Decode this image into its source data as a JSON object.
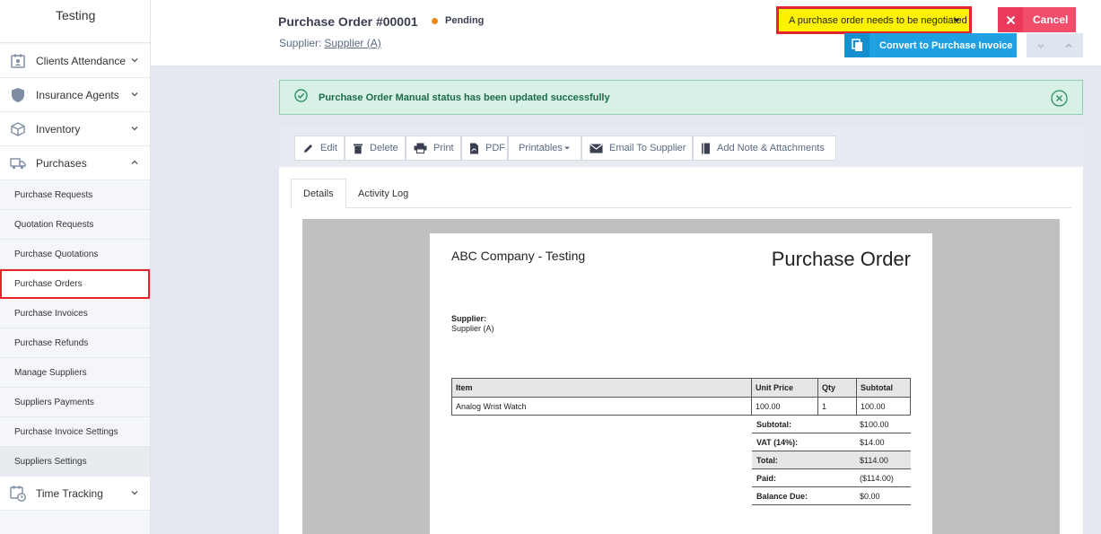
{
  "sidebar": {
    "brand": "Testing",
    "main_items": [
      {
        "label": "Clients Attendance",
        "icon": "calendar-user-icon"
      },
      {
        "label": "Insurance Agents",
        "icon": "shield-icon"
      },
      {
        "label": "Inventory",
        "icon": "box-icon"
      },
      {
        "label": "Purchases",
        "icon": "truck-icon"
      },
      {
        "label": "Time Tracking",
        "icon": "calendar-clock-icon"
      }
    ],
    "sub_items": [
      "Purchase Requests",
      "Quotation Requests",
      "Purchase Quotations",
      "Purchase Orders",
      "Purchase Invoices",
      "Purchase Refunds",
      "Manage Suppliers",
      "Suppliers Payments",
      "Purchase Invoice Settings",
      "Suppliers Settings"
    ],
    "active_sub_item": "Purchase Orders"
  },
  "header": {
    "title": "Purchase Order #00001",
    "status": "Pending",
    "status_color": "#f18a12",
    "supplier_label": "Supplier:",
    "supplier_name": "Supplier (A)",
    "status_select": "A purchase order needs to be negotiated",
    "cancel_label": "Cancel",
    "convert_label": "Convert to Purchase Invoice"
  },
  "alert": {
    "message": "Purchase Order Manual status has been updated successfully"
  },
  "toolbar": {
    "edit": "Edit",
    "delete": "Delete",
    "print": "Print",
    "pdf": "PDF",
    "printables": "Printables",
    "email": "Email To Supplier",
    "note": "Add Note & Attachments"
  },
  "tabs": {
    "details": "Details",
    "activity": "Activity Log"
  },
  "document": {
    "company": "ABC Company - Testing",
    "title": "Purchase Order",
    "supplier_label": "Supplier:",
    "supplier_value": "Supplier (A)",
    "columns": [
      "Item",
      "Unit Price",
      "Qty",
      "Subtotal"
    ],
    "rows": [
      [
        "Analog Wrist Watch",
        "100.00",
        "1",
        "100.00"
      ]
    ],
    "totals": [
      {
        "label": "Subtotal:",
        "value": "$100.00"
      },
      {
        "label": "VAT (14%):",
        "value": "$14.00"
      },
      {
        "label": "Total:",
        "value": "$114.00"
      },
      {
        "label": "Paid:",
        "value": "($114.00)"
      },
      {
        "label": "Balance Due:",
        "value": "$0.00"
      }
    ]
  },
  "colors": {
    "accent_blue": "#1ea0e3",
    "cancel_red": "#f14e6b",
    "highlight_yellow": "#fff200",
    "annotation_red": "#e4232b",
    "success_green": "#1d6b48"
  }
}
